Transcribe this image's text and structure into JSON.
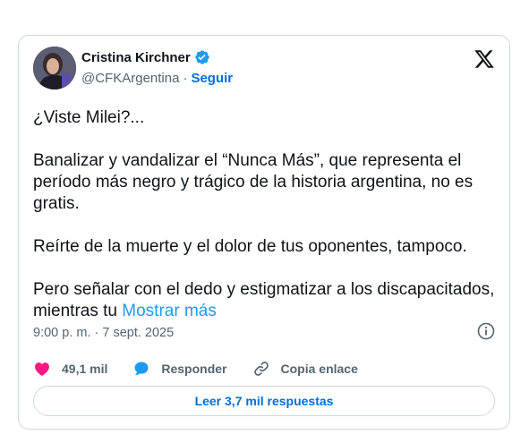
{
  "author": {
    "name": "Cristina Kirchner",
    "handle": "@CFKArgentina",
    "separator": "·",
    "follow_label": "Seguir"
  },
  "tweet": {
    "paragraphs": [
      "¿Viste Milei?...",
      "Banalizar y vandalizar el “Nunca Más”, que representa el período más negro y trágico de la historia argentina, no es gratis.",
      "Reírte de la muerte y el dolor de tus oponentes, tampoco.",
      "Pero señalar con el dedo y estigmatizar a los discapacitados, mientras tu"
    ],
    "show_more": "Mostrar más",
    "timestamp": "9:00 p. m. · 7 sept. 2025"
  },
  "actions": {
    "likes": "49,1 mil",
    "reply": "Responder",
    "copy_link": "Copia enlace"
  },
  "read_replies": "Leer 3,7 mil respuestas",
  "colors": {
    "accent": "#1d9bf0",
    "link": "#006fd6",
    "like_heart": "#f91880",
    "text": "#0f1419",
    "muted": "#536471",
    "border": "#cfd9de"
  },
  "icons": [
    "verified-badge-icon",
    "x-logo-icon",
    "info-icon",
    "heart-icon",
    "reply-icon",
    "link-icon"
  ]
}
